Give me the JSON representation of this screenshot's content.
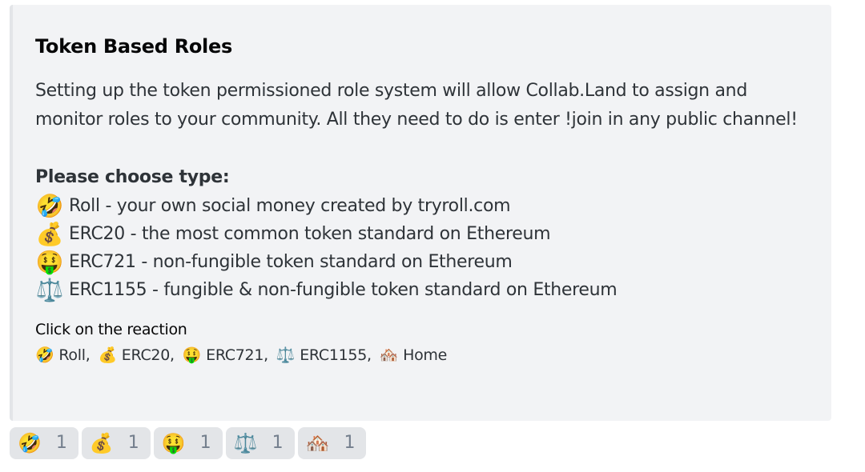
{
  "embed": {
    "title": "Token Based Roles",
    "description": "Setting up the token permissioned role system will allow Collab.Land to assign and monitor roles to your community. All they need to do is enter !join in any public channel!",
    "choose_heading": "Please choose type:",
    "options": [
      {
        "emoji": "🤣",
        "icon": "rofl-emoji-icon",
        "text": "Roll - your own social money created by tryroll.com"
      },
      {
        "emoji": "💰",
        "icon": "money-bag-emoji-icon",
        "text": "ERC20 - the most common token standard on Ethereum"
      },
      {
        "emoji": "🤑",
        "icon": "money-mouth-emoji-icon",
        "text": "ERC721 - non-fungible token standard on Ethereum"
      },
      {
        "emoji": "⚖️",
        "icon": "scales-emoji-icon",
        "text": "ERC1155 - fungible & non-fungible token standard on Ethereum"
      }
    ],
    "field": {
      "name": "Click on the reaction",
      "items": [
        {
          "emoji": "🤣",
          "icon": "rofl-emoji-icon",
          "label": "Roll,"
        },
        {
          "emoji": "💰",
          "icon": "money-bag-emoji-icon",
          "label": "ERC20,"
        },
        {
          "emoji": "🤑",
          "icon": "money-mouth-emoji-icon",
          "label": "ERC721,"
        },
        {
          "emoji": "⚖️",
          "icon": "scales-emoji-icon",
          "label": "ERC1155,"
        },
        {
          "emoji": "🏘️",
          "icon": "houses-emoji-icon",
          "label": "Home"
        }
      ]
    }
  },
  "reactions": [
    {
      "emoji": "🤣",
      "icon": "rofl-emoji-icon",
      "count": "1"
    },
    {
      "emoji": "💰",
      "icon": "money-bag-emoji-icon",
      "count": "1"
    },
    {
      "emoji": "🤑",
      "icon": "money-mouth-emoji-icon",
      "count": "1"
    },
    {
      "emoji": "⚖️",
      "icon": "scales-emoji-icon",
      "count": "1"
    },
    {
      "emoji": "🏘️",
      "icon": "houses-emoji-icon",
      "count": "1"
    }
  ],
  "colors": {
    "embed_background": "#f2f3f5",
    "embed_border": "#e3e5e8",
    "reaction_background": "#e3e5e8",
    "reaction_count": "#747f8d",
    "text": "#2e3338",
    "title": "#060607"
  }
}
